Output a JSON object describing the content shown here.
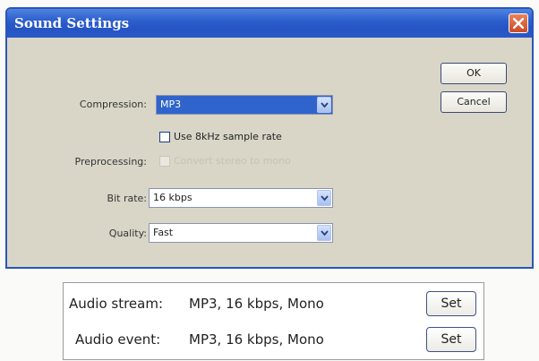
{
  "dialog": {
    "title": "Sound Settings",
    "ok_label": "OK",
    "cancel_label": "Cancel",
    "compression": {
      "label": "Compression:",
      "value": "MP3"
    },
    "use_8khz": {
      "label": "Use 8kHz sample rate",
      "checked": false
    },
    "preprocessing": {
      "label": "Preprocessing:",
      "option_label": "Convert stereo to mono",
      "checked": false,
      "disabled": true
    },
    "bit_rate": {
      "label": "Bit rate:",
      "value": "16 kbps"
    },
    "quality": {
      "label": "Quality:",
      "value": "Fast"
    }
  },
  "panel": {
    "rows": [
      {
        "label": "Audio stream:",
        "value": "MP3, 16 kbps, Mono",
        "button": "Set"
      },
      {
        "label": "Audio event:",
        "value": "MP3, 16 kbps, Mono",
        "button": "Set"
      }
    ]
  },
  "icons": {
    "close": "close-icon",
    "dropdown": "chevron-down-icon"
  },
  "colors": {
    "title_bar": "#2554c4",
    "dialog_face": "#d9d6c8",
    "selection": "#2f64cc",
    "close_button": "#cc4b23"
  }
}
